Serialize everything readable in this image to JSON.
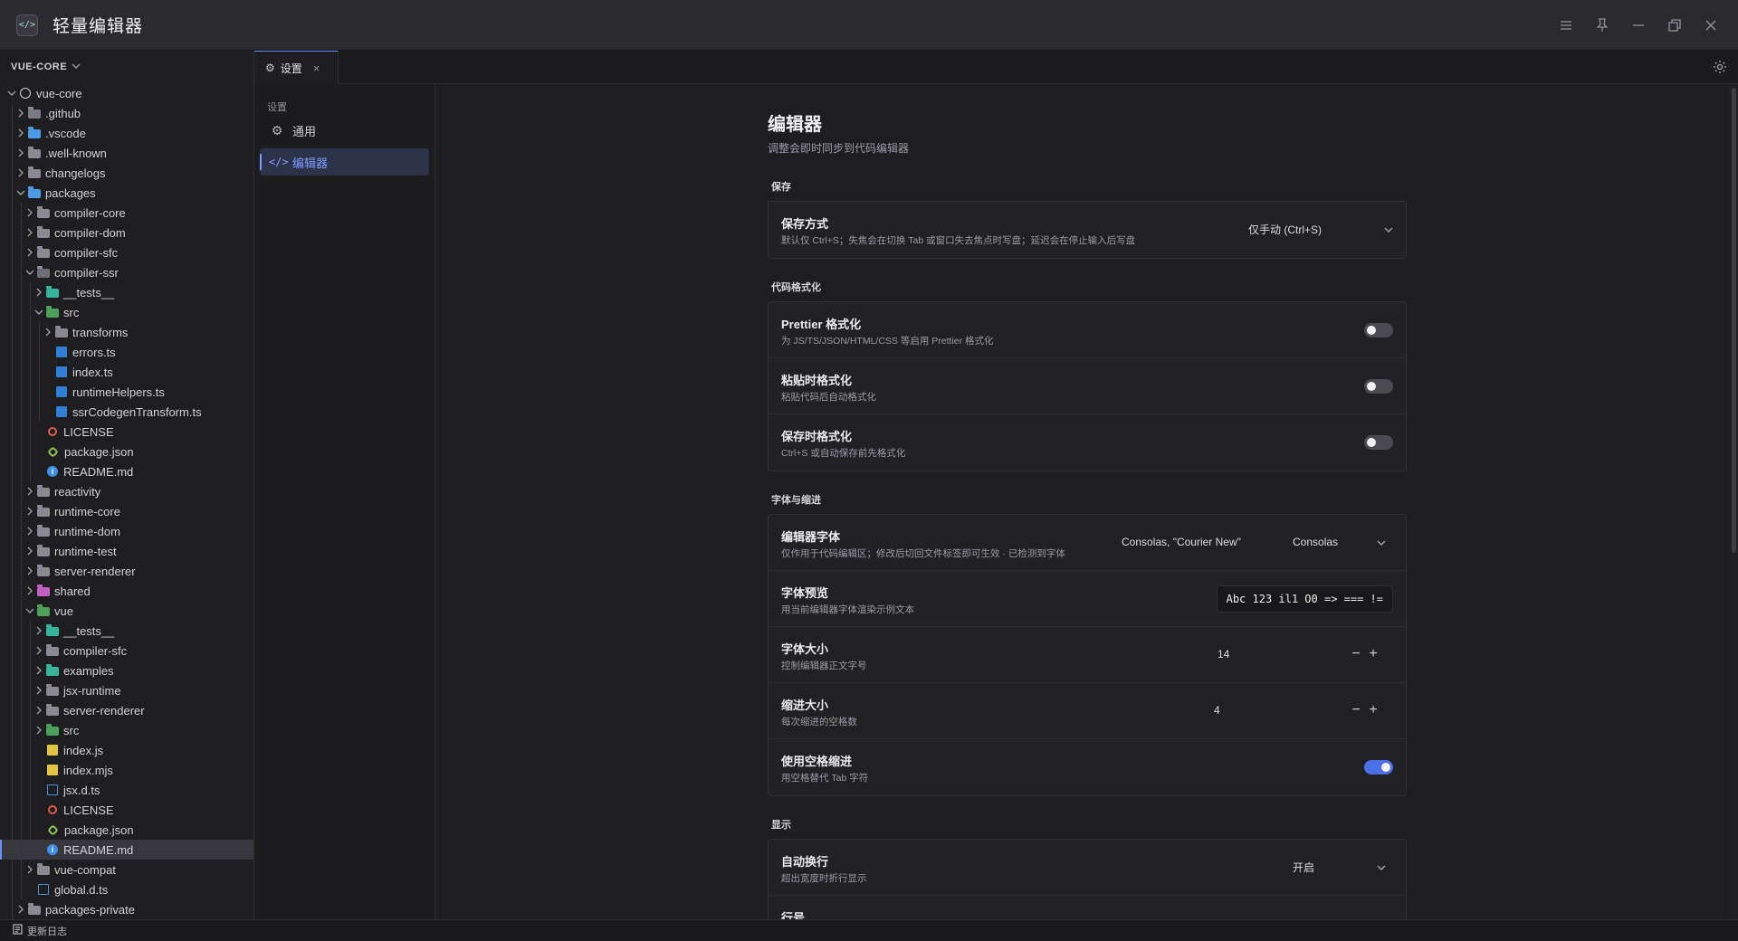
{
  "window": {
    "title": "轻量编辑器",
    "logo_glyph": "</>",
    "controls": [
      "menu-icon",
      "pin-icon",
      "minimize-icon",
      "restore-icon",
      "close-icon"
    ]
  },
  "explorer": {
    "title": "VUE-CORE",
    "tree": [
      {
        "label": "vue-core",
        "depth": 0,
        "type": "root",
        "expanded": true
      },
      {
        "label": ".github",
        "depth": 1,
        "type": "folder",
        "icon": "git"
      },
      {
        "label": ".vscode",
        "depth": 1,
        "type": "folder",
        "icon": "blue"
      },
      {
        "label": ".well-known",
        "depth": 1,
        "type": "folder"
      },
      {
        "label": "changelogs",
        "depth": 1,
        "type": "folder"
      },
      {
        "label": "packages",
        "depth": 1,
        "type": "folder",
        "icon": "blue",
        "expanded": true
      },
      {
        "label": "compiler-core",
        "depth": 2,
        "type": "folder"
      },
      {
        "label": "compiler-dom",
        "depth": 2,
        "type": "folder"
      },
      {
        "label": "compiler-sfc",
        "depth": 2,
        "type": "folder"
      },
      {
        "label": "compiler-ssr",
        "depth": 2,
        "type": "folder",
        "expanded": true
      },
      {
        "label": "__tests__",
        "depth": 3,
        "type": "folder",
        "icon": "teal"
      },
      {
        "label": "src",
        "depth": 3,
        "type": "folder",
        "icon": "green",
        "expanded": true
      },
      {
        "label": "transforms",
        "depth": 4,
        "type": "folder"
      },
      {
        "label": "errors.ts",
        "depth": 4,
        "type": "ts"
      },
      {
        "label": "index.ts",
        "depth": 4,
        "type": "ts"
      },
      {
        "label": "runtimeHelpers.ts",
        "depth": 4,
        "type": "ts"
      },
      {
        "label": "ssrCodegenTransform.ts",
        "depth": 4,
        "type": "ts"
      },
      {
        "label": "LICENSE",
        "depth": 3,
        "type": "license"
      },
      {
        "label": "package.json",
        "depth": 3,
        "type": "pkg"
      },
      {
        "label": "README.md",
        "depth": 3,
        "type": "info"
      },
      {
        "label": "reactivity",
        "depth": 2,
        "type": "folder"
      },
      {
        "label": "runtime-core",
        "depth": 2,
        "type": "folder"
      },
      {
        "label": "runtime-dom",
        "depth": 2,
        "type": "folder"
      },
      {
        "label": "runtime-test",
        "depth": 2,
        "type": "folder"
      },
      {
        "label": "server-renderer",
        "depth": 2,
        "type": "folder"
      },
      {
        "label": "shared",
        "depth": 2,
        "type": "folder",
        "icon": "pink"
      },
      {
        "label": "vue",
        "depth": 2,
        "type": "folder",
        "icon": "green",
        "expanded": true
      },
      {
        "label": "__tests__",
        "depth": 3,
        "type": "folder",
        "icon": "teal"
      },
      {
        "label": "compiler-sfc",
        "depth": 3,
        "type": "folder"
      },
      {
        "label": "examples",
        "depth": 3,
        "type": "folder",
        "icon": "teal"
      },
      {
        "label": "jsx-runtime",
        "depth": 3,
        "type": "folder"
      },
      {
        "label": "server-renderer",
        "depth": 3,
        "type": "folder"
      },
      {
        "label": "src",
        "depth": 3,
        "type": "folder",
        "icon": "green"
      },
      {
        "label": "index.js",
        "depth": 3,
        "type": "js"
      },
      {
        "label": "index.mjs",
        "depth": 3,
        "type": "js"
      },
      {
        "label": "jsx.d.ts",
        "depth": 3,
        "type": "dts"
      },
      {
        "label": "LICENSE",
        "depth": 3,
        "type": "license"
      },
      {
        "label": "package.json",
        "depth": 3,
        "type": "pkg"
      },
      {
        "label": "README.md",
        "depth": 3,
        "type": "info",
        "selected": true
      },
      {
        "label": "vue-compat",
        "depth": 2,
        "type": "folder"
      },
      {
        "label": "global.d.ts",
        "depth": 2,
        "type": "dts"
      },
      {
        "label": "packages-private",
        "depth": 1,
        "type": "folder"
      }
    ]
  },
  "tabs": [
    {
      "label": "设置",
      "active": true
    }
  ],
  "settings_nav": {
    "caption": "设置",
    "items": [
      {
        "label": "通用",
        "icon": "gear-icon",
        "active": false
      },
      {
        "label": "编辑器",
        "icon": "code-icon",
        "active": true
      }
    ]
  },
  "page": {
    "title": "编辑器",
    "subtitle": "调整会即时同步到代码编辑器",
    "sections": {
      "save": {
        "heading": "保存",
        "save_mode": {
          "title": "保存方式",
          "desc": "默认仅 Ctrl+S；失焦会在切换 Tab 或窗口失去焦点时写盘；延迟会在停止输入后写盘",
          "value": "仅手动 (Ctrl+S)"
        }
      },
      "format": {
        "heading": "代码格式化",
        "prettier": {
          "title": "Prettier 格式化",
          "desc": "为 JS/TS/JSON/HTML/CSS 等启用 Prettier 格式化",
          "on": false
        },
        "paste": {
          "title": "粘贴时格式化",
          "desc": "粘贴代码后自动格式化",
          "on": false
        },
        "onsave": {
          "title": "保存时格式化",
          "desc": "Ctrl+S 或自动保存前先格式化",
          "on": false
        }
      },
      "font": {
        "heading": "字体与缩进",
        "editor_font": {
          "title": "编辑器字体",
          "desc": "仅作用于代码编辑区；修改后切回文件标签即可生效 · 已检测到字体",
          "input_value": "Consolas, \"Courier New\"",
          "preset_value": "Consolas"
        },
        "preview": {
          "title": "字体预览",
          "desc": "用当前编辑器字体渲染示例文本",
          "sample": "Abc 123 il1 O0 => === !="
        },
        "font_size": {
          "title": "字体大小",
          "desc": "控制编辑器正文字号",
          "value": "14",
          "minus": "−",
          "plus": "+"
        },
        "indent_size": {
          "title": "缩进大小",
          "desc": "每次缩进的空格数",
          "value": "4",
          "minus": "−",
          "plus": "+"
        },
        "use_spaces": {
          "title": "使用空格缩进",
          "desc": "用空格替代 Tab 字符",
          "on": true
        }
      },
      "display": {
        "heading": "显示",
        "word_wrap": {
          "title": "自动换行",
          "desc": "超出宽度时折行显示",
          "value": "开启"
        },
        "line_numbers": {
          "title": "行号"
        }
      }
    }
  },
  "statusbar": {
    "changelog": "更新日志"
  },
  "colors": {
    "accent": "#6b8cff",
    "toggle_on": "#4c6fe8"
  }
}
